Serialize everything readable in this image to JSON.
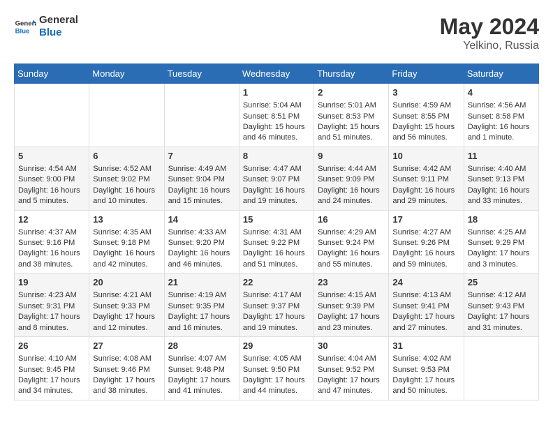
{
  "header": {
    "logo_text_general": "General",
    "logo_text_blue": "Blue",
    "month_year": "May 2024",
    "location": "Yelkino, Russia"
  },
  "weekdays": [
    "Sunday",
    "Monday",
    "Tuesday",
    "Wednesday",
    "Thursday",
    "Friday",
    "Saturday"
  ],
  "rows": [
    [
      {
        "day": "",
        "lines": []
      },
      {
        "day": "",
        "lines": []
      },
      {
        "day": "",
        "lines": []
      },
      {
        "day": "1",
        "lines": [
          "Sunrise: 5:04 AM",
          "Sunset: 8:51 PM",
          "Daylight: 15 hours",
          "and 46 minutes."
        ]
      },
      {
        "day": "2",
        "lines": [
          "Sunrise: 5:01 AM",
          "Sunset: 8:53 PM",
          "Daylight: 15 hours",
          "and 51 minutes."
        ]
      },
      {
        "day": "3",
        "lines": [
          "Sunrise: 4:59 AM",
          "Sunset: 8:55 PM",
          "Daylight: 15 hours",
          "and 56 minutes."
        ]
      },
      {
        "day": "4",
        "lines": [
          "Sunrise: 4:56 AM",
          "Sunset: 8:58 PM",
          "Daylight: 16 hours",
          "and 1 minute."
        ]
      }
    ],
    [
      {
        "day": "5",
        "lines": [
          "Sunrise: 4:54 AM",
          "Sunset: 9:00 PM",
          "Daylight: 16 hours",
          "and 5 minutes."
        ]
      },
      {
        "day": "6",
        "lines": [
          "Sunrise: 4:52 AM",
          "Sunset: 9:02 PM",
          "Daylight: 16 hours",
          "and 10 minutes."
        ]
      },
      {
        "day": "7",
        "lines": [
          "Sunrise: 4:49 AM",
          "Sunset: 9:04 PM",
          "Daylight: 16 hours",
          "and 15 minutes."
        ]
      },
      {
        "day": "8",
        "lines": [
          "Sunrise: 4:47 AM",
          "Sunset: 9:07 PM",
          "Daylight: 16 hours",
          "and 19 minutes."
        ]
      },
      {
        "day": "9",
        "lines": [
          "Sunrise: 4:44 AM",
          "Sunset: 9:09 PM",
          "Daylight: 16 hours",
          "and 24 minutes."
        ]
      },
      {
        "day": "10",
        "lines": [
          "Sunrise: 4:42 AM",
          "Sunset: 9:11 PM",
          "Daylight: 16 hours",
          "and 29 minutes."
        ]
      },
      {
        "day": "11",
        "lines": [
          "Sunrise: 4:40 AM",
          "Sunset: 9:13 PM",
          "Daylight: 16 hours",
          "and 33 minutes."
        ]
      }
    ],
    [
      {
        "day": "12",
        "lines": [
          "Sunrise: 4:37 AM",
          "Sunset: 9:16 PM",
          "Daylight: 16 hours",
          "and 38 minutes."
        ]
      },
      {
        "day": "13",
        "lines": [
          "Sunrise: 4:35 AM",
          "Sunset: 9:18 PM",
          "Daylight: 16 hours",
          "and 42 minutes."
        ]
      },
      {
        "day": "14",
        "lines": [
          "Sunrise: 4:33 AM",
          "Sunset: 9:20 PM",
          "Daylight: 16 hours",
          "and 46 minutes."
        ]
      },
      {
        "day": "15",
        "lines": [
          "Sunrise: 4:31 AM",
          "Sunset: 9:22 PM",
          "Daylight: 16 hours",
          "and 51 minutes."
        ]
      },
      {
        "day": "16",
        "lines": [
          "Sunrise: 4:29 AM",
          "Sunset: 9:24 PM",
          "Daylight: 16 hours",
          "and 55 minutes."
        ]
      },
      {
        "day": "17",
        "lines": [
          "Sunrise: 4:27 AM",
          "Sunset: 9:26 PM",
          "Daylight: 16 hours",
          "and 59 minutes."
        ]
      },
      {
        "day": "18",
        "lines": [
          "Sunrise: 4:25 AM",
          "Sunset: 9:29 PM",
          "Daylight: 17 hours",
          "and 3 minutes."
        ]
      }
    ],
    [
      {
        "day": "19",
        "lines": [
          "Sunrise: 4:23 AM",
          "Sunset: 9:31 PM",
          "Daylight: 17 hours",
          "and 8 minutes."
        ]
      },
      {
        "day": "20",
        "lines": [
          "Sunrise: 4:21 AM",
          "Sunset: 9:33 PM",
          "Daylight: 17 hours",
          "and 12 minutes."
        ]
      },
      {
        "day": "21",
        "lines": [
          "Sunrise: 4:19 AM",
          "Sunset: 9:35 PM",
          "Daylight: 17 hours",
          "and 16 minutes."
        ]
      },
      {
        "day": "22",
        "lines": [
          "Sunrise: 4:17 AM",
          "Sunset: 9:37 PM",
          "Daylight: 17 hours",
          "and 19 minutes."
        ]
      },
      {
        "day": "23",
        "lines": [
          "Sunrise: 4:15 AM",
          "Sunset: 9:39 PM",
          "Daylight: 17 hours",
          "and 23 minutes."
        ]
      },
      {
        "day": "24",
        "lines": [
          "Sunrise: 4:13 AM",
          "Sunset: 9:41 PM",
          "Daylight: 17 hours",
          "and 27 minutes."
        ]
      },
      {
        "day": "25",
        "lines": [
          "Sunrise: 4:12 AM",
          "Sunset: 9:43 PM",
          "Daylight: 17 hours",
          "and 31 minutes."
        ]
      }
    ],
    [
      {
        "day": "26",
        "lines": [
          "Sunrise: 4:10 AM",
          "Sunset: 9:45 PM",
          "Daylight: 17 hours",
          "and 34 minutes."
        ]
      },
      {
        "day": "27",
        "lines": [
          "Sunrise: 4:08 AM",
          "Sunset: 9:46 PM",
          "Daylight: 17 hours",
          "and 38 minutes."
        ]
      },
      {
        "day": "28",
        "lines": [
          "Sunrise: 4:07 AM",
          "Sunset: 9:48 PM",
          "Daylight: 17 hours",
          "and 41 minutes."
        ]
      },
      {
        "day": "29",
        "lines": [
          "Sunrise: 4:05 AM",
          "Sunset: 9:50 PM",
          "Daylight: 17 hours",
          "and 44 minutes."
        ]
      },
      {
        "day": "30",
        "lines": [
          "Sunrise: 4:04 AM",
          "Sunset: 9:52 PM",
          "Daylight: 17 hours",
          "and 47 minutes."
        ]
      },
      {
        "day": "31",
        "lines": [
          "Sunrise: 4:02 AM",
          "Sunset: 9:53 PM",
          "Daylight: 17 hours",
          "and 50 minutes."
        ]
      },
      {
        "day": "",
        "lines": []
      }
    ]
  ]
}
